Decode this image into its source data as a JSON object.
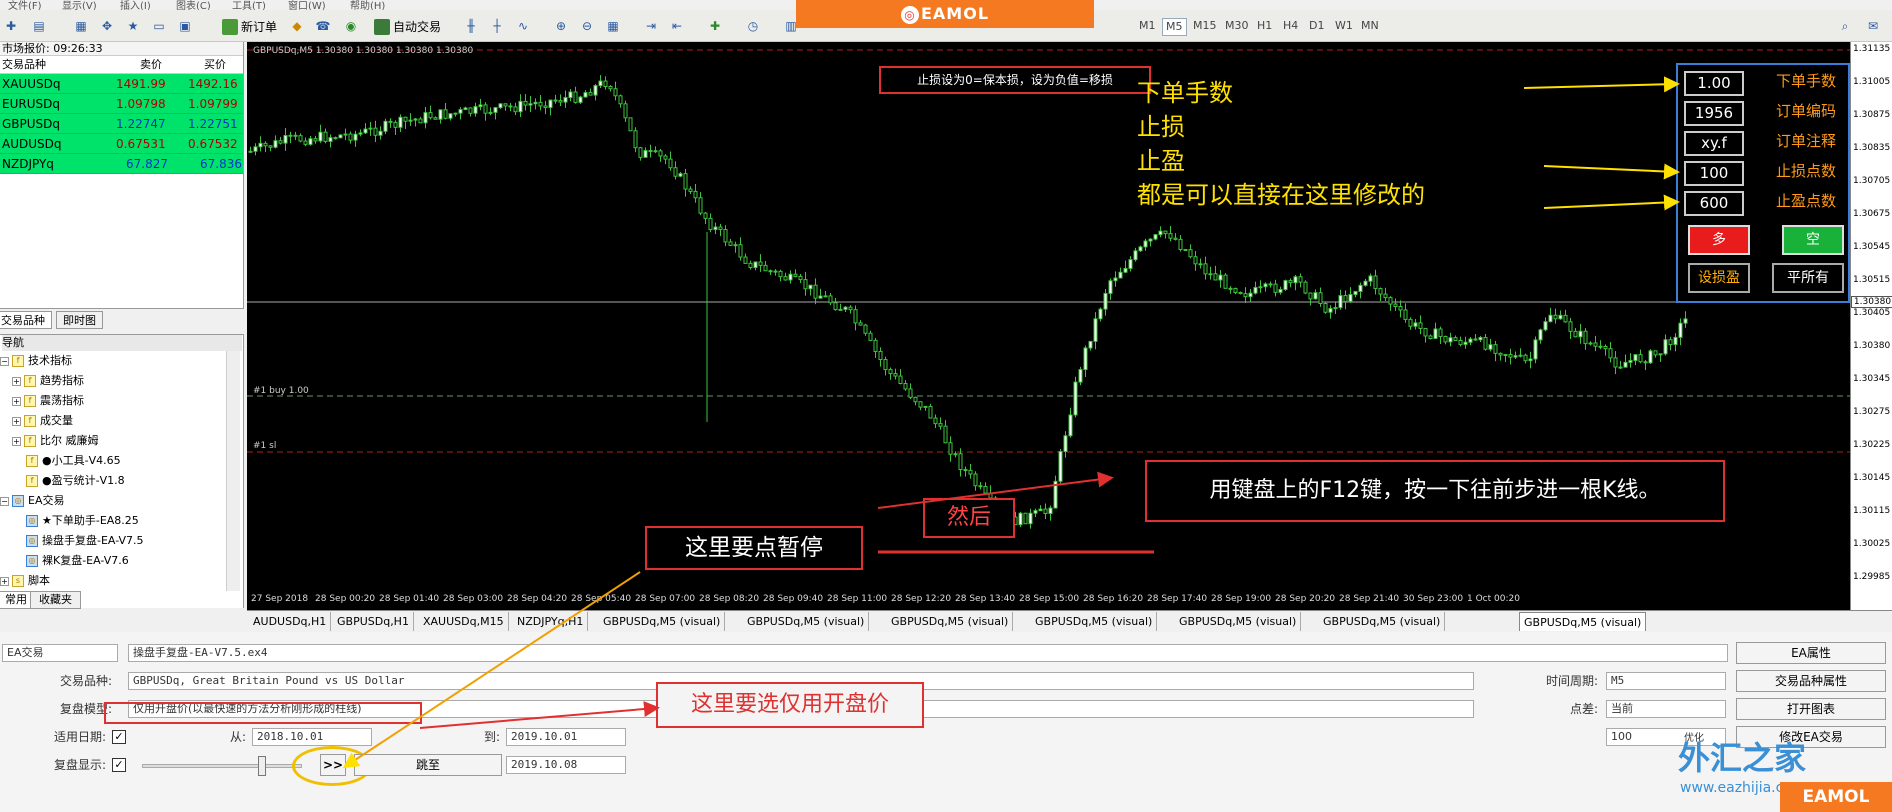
{
  "menu": [
    "文件(F)",
    "显示(V)",
    "插入(I)",
    "图表(C)",
    "工具(T)",
    "窗口(W)",
    "帮助(H)"
  ],
  "toolbar": {
    "new_order": "新订单",
    "auto_trading": "自动交易",
    "timeframes": [
      "M1",
      "M5",
      "M15",
      "M30",
      "H1",
      "H4",
      "D1",
      "W1",
      "MN"
    ],
    "active_timeframe": "M5"
  },
  "banner": {
    "logo": "EAMOL"
  },
  "market_watch": {
    "title": "市场报价: 09:26:33",
    "col_symbol": "交易品种",
    "col_bid": "卖价",
    "col_ask": "买价",
    "rows": [
      {
        "symbol": "XAUUSDq",
        "bid": "1491.99",
        "ask": "1492.16"
      },
      {
        "symbol": "EURUSDq",
        "bid": "1.09798",
        "ask": "1.09799"
      },
      {
        "symbol": "GBPUSDq",
        "bid": "1.22747",
        "ask": "1.22751"
      },
      {
        "symbol": "AUDUSDq",
        "bid": "0.67531",
        "ask": "0.67532"
      },
      {
        "symbol": "NZDJPYq",
        "bid": "67.827",
        "ask": "67.836"
      }
    ],
    "tabs": [
      "交易品种",
      "即时图"
    ]
  },
  "navigator": {
    "title": "导航",
    "items": [
      "技术指标",
      "趋势指标",
      "震荡指标",
      "成交量",
      "比尔 威廉姆",
      "●小工具-V4.65",
      "●盈亏统计-V1.8",
      "EA交易",
      "★下单助手-EA8.25",
      "操盘手复盘-EA-V7.5",
      "裸K复盘-EA-V7.6",
      "脚本"
    ],
    "tabs": [
      "常用",
      "收藏夹"
    ]
  },
  "chart": {
    "header": "GBPUSDq,M5  1.30380 1.30380 1.30380 1.30380",
    "buy_line_label": "#1 buy 1.00",
    "sl_line_label": "#1 sl",
    "y_ticks": [
      "1.31135",
      "1.31005",
      "1.30875",
      "1.30835",
      "1.30705",
      "1.30675",
      "1.30545",
      "1.30515",
      "1.30405",
      "1.30380",
      "1.30345",
      "1.30275",
      "1.30225",
      "1.30145",
      "1.30115",
      "1.30025",
      "1.29985"
    ],
    "price_tag": "1.30380",
    "x_ticks": [
      "27 Sep 2018",
      "28 Sep 00:20",
      "28 Sep 01:40",
      "28 Sep 03:00",
      "28 Sep 04:20",
      "28 Sep 05:40",
      "28 Sep 07:00",
      "28 Sep 08:20",
      "28 Sep 09:40",
      "28 Sep 11:00",
      "28 Sep 12:20",
      "28 Sep 13:40",
      "28 Sep 15:00",
      "28 Sep 16:20",
      "28 Sep 17:40",
      "28 Sep 19:00",
      "28 Sep 20:20",
      "28 Sep 21:40",
      "30 Sep 23:00",
      "1 Oct 00:20"
    ]
  },
  "ea_panel": {
    "lot_value": "1.00",
    "lot_label": "下单手数",
    "order_id_value": "1956",
    "order_id_label": "订单编码",
    "comment_value": "xy.f",
    "comment_label": "订单注释",
    "sl_value": "100",
    "sl_label": "止损点数",
    "tp_value": "600",
    "tp_label": "止盈点数",
    "buy": "多",
    "sell": "空",
    "set_sltp": "设损盈",
    "close_all": "平所有"
  },
  "annotations": {
    "top_note": "止损设为0=保本损，设为负值=移损",
    "yellow_lines": [
      "下单手数",
      "止损",
      "止盈",
      "都是可以直接在这里修改的"
    ],
    "f12_note": "用键盘上的F12键，按一下往前步进一根K线。",
    "then": "然后",
    "pause_note": "这里要点暂停",
    "open_price_note": "这里要选仅用开盘价"
  },
  "chart_tabs": [
    "AUDUSDq,H1",
    "GBPUSDq,H1",
    "XAUUSDq,M15",
    "NZDJPYq,H1",
    "GBPUSDq,M5 (visual)",
    "GBPUSDq,M5 (visual)",
    "GBPUSDq,M5 (visual)",
    "GBPUSDq,M5 (visual)",
    "GBPUSDq,M5 (visual)",
    "GBPUSDq,M5 (visual)",
    "GBPUSDq,M5 (visual)"
  ],
  "tester": {
    "type": "EA交易",
    "expert": "操盘手复盘-EA-V7.5.ex4",
    "symbol_label": "交易品种:",
    "symbol": "GBPUSDq, Great Britain Pound vs US Dollar",
    "model_label": "复盘模型:",
    "model": "仅用开盘价(以最快速的方法分析刚形成的柱线)",
    "use_date_label": "适用日期:",
    "from_label": "从:",
    "from": "2018.10.01",
    "to_label": "到:",
    "to": "2019.10.01",
    "visual_label": "复盘显示:",
    "skip_button": "跳至",
    "skip_to": "2019.10.08",
    "period_label": "时间周期:",
    "period": "M5",
    "spread_label": "点差:",
    "spread": "当前",
    "spread_value": "100",
    "optimize_label": "优化",
    "btn_expert_props": "EA属性",
    "btn_symbol_props": "交易品种属性",
    "btn_open_chart": "打开图表",
    "btn_modify_expert": "修改EA交易",
    "pause_button": ">>"
  },
  "watermark": {
    "site": "外汇之家",
    "url": "www.eazhijia.com",
    "badge": "EAMOL"
  }
}
